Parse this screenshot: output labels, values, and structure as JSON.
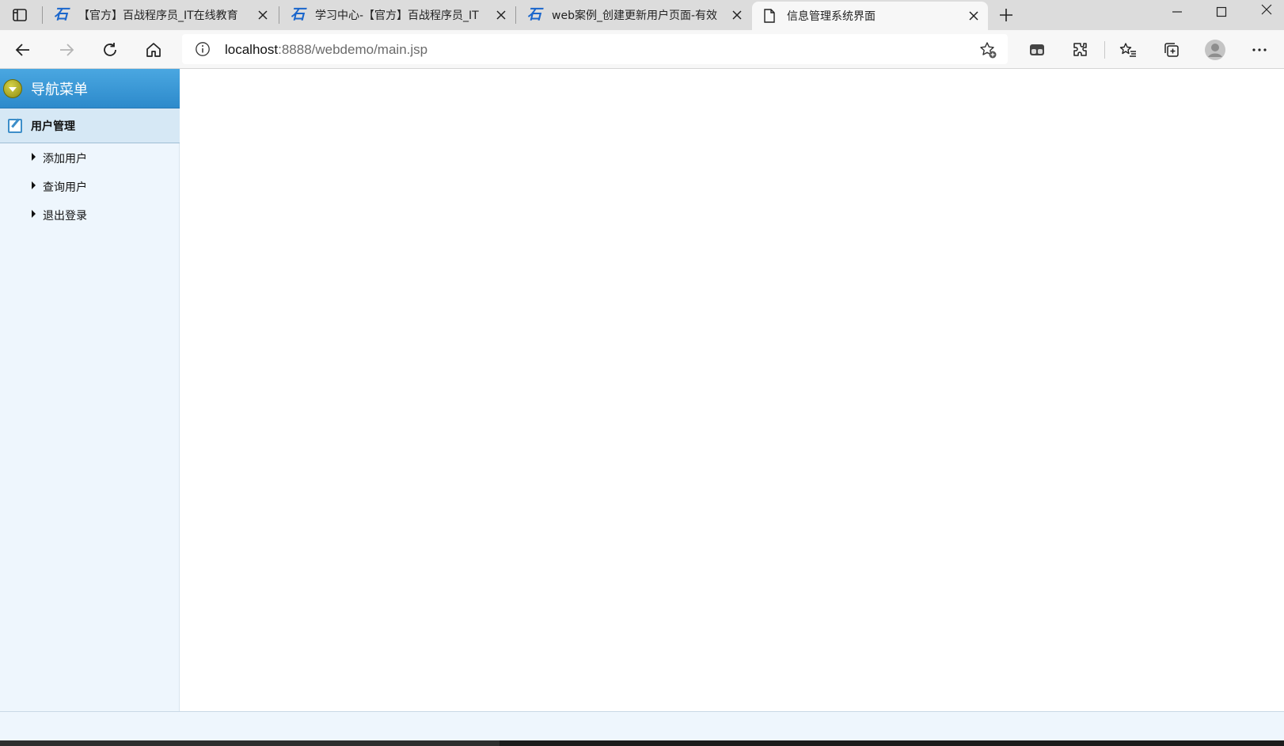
{
  "browser": {
    "tabs": [
      {
        "title": "【官方】百战程序员_IT在线教育",
        "favicon": "bz-logo-icon",
        "active": false
      },
      {
        "title": "学习中心-【官方】百战程序员_IT",
        "favicon": "bz-logo-icon",
        "active": false
      },
      {
        "title": "web案例_创建更新用户页面-有效",
        "favicon": "bz-logo-icon",
        "active": false
      },
      {
        "title": "信息管理系统界面",
        "favicon": "page-icon",
        "active": true
      }
    ],
    "address": {
      "host": "localhost",
      "rest": ":8888/webdemo/main.jsp"
    }
  },
  "sidebar": {
    "header_label": "导航菜单",
    "group_label": "用户管理",
    "items": [
      {
        "label": "添加用户"
      },
      {
        "label": "查询用户"
      },
      {
        "label": "退出登录"
      }
    ]
  },
  "colors": {
    "header_blue": "#3a9ad8",
    "sidebar_bg": "#eef6fd",
    "group_bg": "#d6e8f5",
    "brand_blue": "#1a66cc"
  }
}
